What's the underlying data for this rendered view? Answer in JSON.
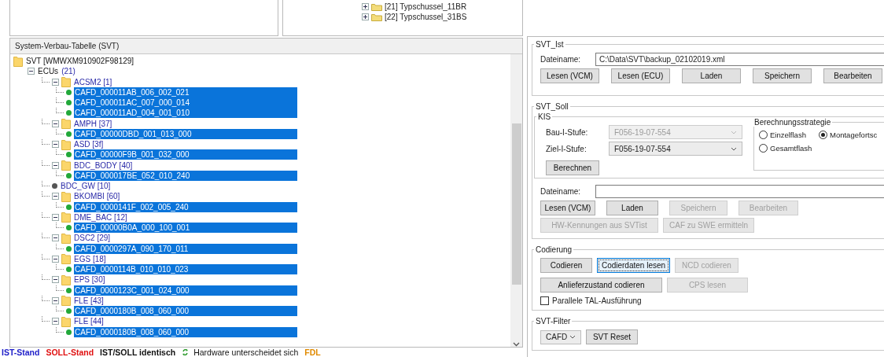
{
  "top_tree": [
    {
      "label": "[21] Typschussel_11BR",
      "expanded": false
    },
    {
      "label": "[22] Typschussel_31BS",
      "expanded": false
    }
  ],
  "svt_panel": {
    "title": "System-Verbau-Tabelle (SVT)",
    "tree": {
      "label": "SVT [WMWXM910902F98129]",
      "kind": "folder",
      "children": [
        {
          "label": "ECUs",
          "count": "(21)",
          "kind": "group",
          "expanded": true,
          "children": [
            {
              "label": "ACSM2 [1]",
              "kind": "folder",
              "expanded": true,
              "children": [
                {
                  "label": "CAFD_000011AB_006_002_021",
                  "kind": "dot",
                  "color": "#22a83a",
                  "selected": true
                },
                {
                  "label": "CAFD_000011AC_007_000_014",
                  "kind": "dot",
                  "color": "#22a83a",
                  "selected": true
                },
                {
                  "label": "CAFD_000011AD_004_001_010",
                  "kind": "dot",
                  "color": "#22a83a",
                  "selected": true
                }
              ]
            },
            {
              "label": "AMPH [37]",
              "kind": "folder",
              "expanded": true,
              "children": [
                {
                  "label": "CAFD_00000DBD_001_013_000",
                  "kind": "dot",
                  "color": "#22a83a",
                  "selected": true
                }
              ]
            },
            {
              "label": "ASD [3f]",
              "kind": "folder",
              "expanded": true,
              "children": [
                {
                  "label": "CAFD_00000F9B_001_032_000",
                  "kind": "dot",
                  "color": "#22a83a",
                  "selected": true
                }
              ]
            },
            {
              "label": "BDC_BODY [40]",
              "kind": "folder",
              "expanded": true,
              "children": [
                {
                  "label": "CAFD_000017BE_052_010_240",
                  "kind": "dot",
                  "color": "#22a83a",
                  "selected": true
                }
              ]
            },
            {
              "label": "BDC_GW [10]",
              "kind": "dot",
              "color": "#555555",
              "selected": false
            },
            {
              "label": "BKOMBI [60]",
              "kind": "folder",
              "expanded": true,
              "children": [
                {
                  "label": "CAFD_0000141F_002_005_240",
                  "kind": "dot",
                  "color": "#22a83a",
                  "selected": true
                }
              ]
            },
            {
              "label": "DME_BAC [12]",
              "kind": "folder",
              "expanded": true,
              "children": [
                {
                  "label": "CAFD_00000B0A_000_100_001",
                  "kind": "dot",
                  "color": "#22a83a",
                  "selected": true
                }
              ]
            },
            {
              "label": "DSC2 [29]",
              "kind": "folder",
              "expanded": true,
              "children": [
                {
                  "label": "CAFD_0000297A_090_170_011",
                  "kind": "dot",
                  "color": "#22a83a",
                  "selected": true
                }
              ]
            },
            {
              "label": "EGS [18]",
              "kind": "folder",
              "expanded": true,
              "children": [
                {
                  "label": "CAFD_0000114B_010_010_023",
                  "kind": "dot",
                  "color": "#22a83a",
                  "selected": true
                }
              ]
            },
            {
              "label": "EPS [30]",
              "kind": "folder",
              "expanded": true,
              "children": [
                {
                  "label": "CAFD_0000123C_001_024_000",
                  "kind": "dot",
                  "color": "#22a83a",
                  "selected": true
                }
              ]
            },
            {
              "label": "FLE [43]",
              "kind": "folder",
              "expanded": true,
              "children": [
                {
                  "label": "CAFD_0000180B_008_060_000",
                  "kind": "dot",
                  "color": "#22a83a",
                  "selected": true
                }
              ]
            },
            {
              "label": "FLE [44]",
              "kind": "folder",
              "expanded": true,
              "children": [
                {
                  "label": "CAFD_0000180B_008_060_000",
                  "kind": "dot",
                  "color": "#22a83a",
                  "selected": true
                }
              ]
            }
          ]
        }
      ]
    }
  },
  "legend": [
    {
      "label": "IST-Stand",
      "kind": "text",
      "color": "#1c1cc8"
    },
    {
      "label": "SOLL-Stand",
      "kind": "text",
      "color": "#e01010"
    },
    {
      "label": "IST/SOLL identisch",
      "kind": "text",
      "color": "#111111"
    },
    {
      "label": "Hardware unterscheidet sich",
      "kind": "icon",
      "color": "#111111"
    },
    {
      "label": "FDL",
      "kind": "text",
      "color": "#e08a00"
    }
  ],
  "svt_ist": {
    "title": "SVT_Ist",
    "filename_label": "Dateiname:",
    "filename": "C:\\Data\\SVT\\backup_02102019.xml",
    "buttons": [
      {
        "label": "Lesen (VCM)",
        "disabled": false
      },
      {
        "label": "Lesen (ECU)",
        "disabled": false
      },
      {
        "label": "Laden",
        "disabled": false
      },
      {
        "label": "Speichern",
        "disabled": false
      },
      {
        "label": "Bearbeiten",
        "disabled": false
      }
    ]
  },
  "svt_soll": {
    "title": "SVT_Soll",
    "kis": {
      "title": "KIS",
      "fields": [
        {
          "label": "Bau-I-Stufe:",
          "value": "F056-19-07-554",
          "disabled": true
        },
        {
          "label": "Ziel-I-Stufe:",
          "value": "F056-19-07-554",
          "disabled": false
        }
      ],
      "button": {
        "label": "Berechnen",
        "disabled": false
      },
      "strategy": {
        "title": "Berechnungsstrategie",
        "options": [
          {
            "label": "Einzelflash",
            "selected": false
          },
          {
            "label": "Montagefortsc",
            "selected": true
          },
          {
            "label": "Gesamtflash",
            "selected": false
          }
        ]
      }
    },
    "filename_label": "Dateiname:",
    "button_rows": [
      [
        {
          "label": "Lesen (VCM)",
          "disabled": false
        },
        {
          "label": "Laden",
          "disabled": false
        },
        {
          "label": "Speichern",
          "disabled": true
        },
        {
          "label": "Bearbeiten",
          "disabled": true
        }
      ],
      [
        {
          "label": "HW-Kennungen aus SVTist",
          "disabled": true
        },
        {
          "label": "CAF zu SWE ermitteln",
          "disabled": true
        }
      ]
    ]
  },
  "codierung": {
    "title": "Codierung",
    "button_rows": [
      [
        {
          "label": "Codieren",
          "disabled": false,
          "focused": false
        },
        {
          "label": "Codierdaten lesen",
          "disabled": false,
          "focused": true
        },
        {
          "label": "NCD codieren",
          "disabled": true,
          "focused": false
        }
      ],
      [
        {
          "label": "Anlieferzustand codieren",
          "disabled": false,
          "focused": false
        },
        {
          "label": "CPS lesen",
          "disabled": true,
          "focused": false
        }
      ]
    ],
    "checkbox": {
      "label": "Parallele TAL-Ausführung",
      "checked": false
    }
  },
  "svt_filter": {
    "title": "SVT-Filter",
    "combo": "CAFD",
    "button": {
      "label": "SVT Reset",
      "disabled": false
    }
  }
}
